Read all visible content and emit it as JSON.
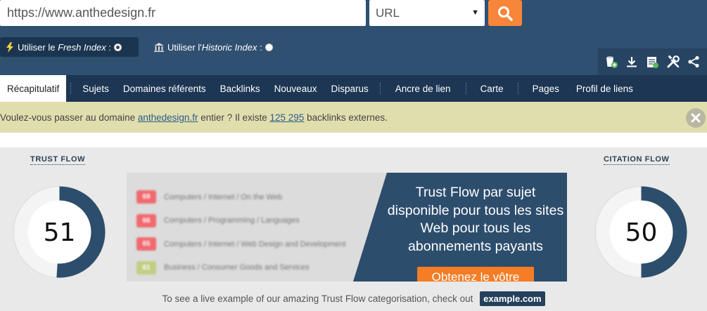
{
  "search": {
    "url_value": "https://www.anthedesign.fr",
    "type_selected": "URL"
  },
  "index_options": {
    "fresh_prefix": "Utiliser le ",
    "fresh_italic": "Fresh Index",
    "fresh_suffix": " :",
    "historic_prefix": "Utiliser l'",
    "historic_italic": "Historic Index",
    "historic_suffix": " :"
  },
  "nav": {
    "tabs": [
      "Récapitulatif",
      "Sujets",
      "Domaines référents",
      "Backlinks",
      "Nouveaux",
      "Disparus",
      "Ancre de lien",
      "Carte",
      "Pages",
      "Profil de liens"
    ]
  },
  "notice": {
    "text_1": "Voulez-vous passer au domaine ",
    "domain_link": "anthedesign.fr",
    "text_2": " entier ? Il existe ",
    "count_link": "125 295",
    "text_3": " backlinks externes."
  },
  "trust_flow": {
    "title": "TRUST FLOW",
    "value": 51
  },
  "citation_flow": {
    "title": "CITATION FLOW",
    "value": 50
  },
  "promo": {
    "rows": [
      {
        "score": "69",
        "category": "Computers / Internet / On the Web",
        "color": "#f0696f"
      },
      {
        "score": "66",
        "category": "Computers / Programming / Languages",
        "color": "#f0696f"
      },
      {
        "score": "65",
        "category": "Computers / Internet / Web Design and Development",
        "color": "#f0696f"
      },
      {
        "score": "61",
        "category": "Business / Consumer Goods and Services",
        "color": "#c3cd83"
      }
    ],
    "text": "Trust Flow par sujet disponible pour tous les sites Web pour tous les abonnements payants",
    "button": "Obtenez le vôtre"
  },
  "example": {
    "text": "To see a live example of our amazing Trust Flow categorisation, check out",
    "link": "example.com"
  },
  "colors": {
    "header": "#2f5071",
    "nav": "#1c3653",
    "accent": "#f7853a",
    "gauge_fill": "#2d4d6c",
    "notice": "#e1deae"
  }
}
